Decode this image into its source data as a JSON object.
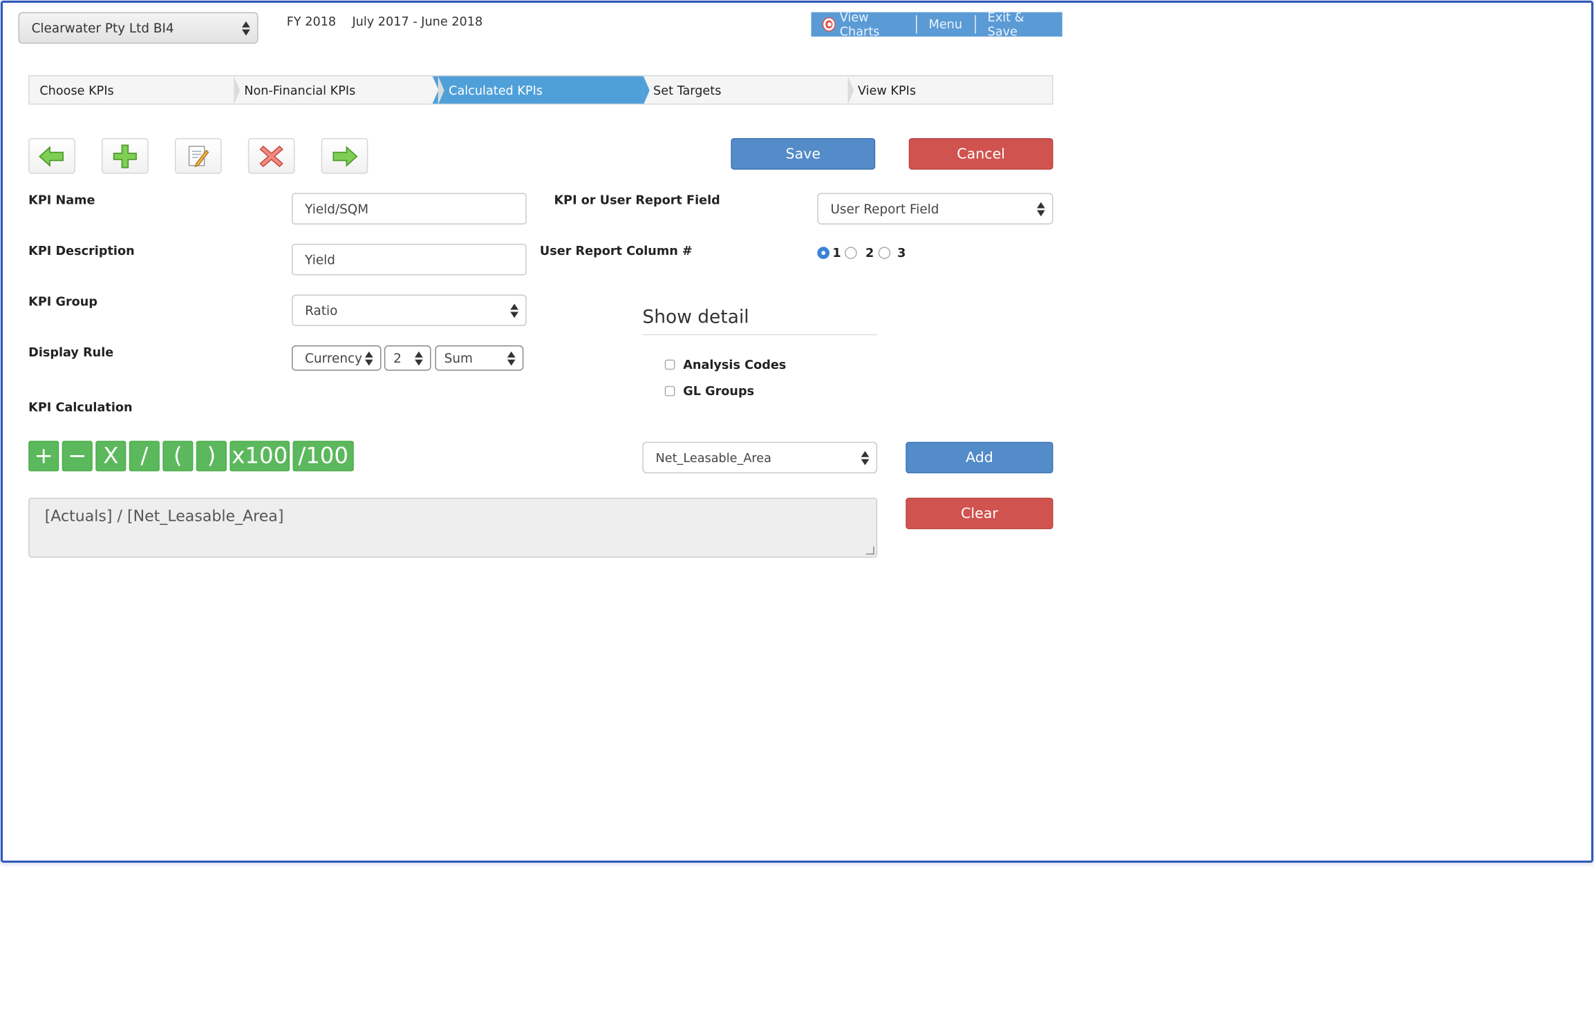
{
  "header": {
    "company": "Clearwater Pty Ltd BI4",
    "fiscal_year": "FY 2018",
    "period": "July 2017 - June 2018",
    "nav": {
      "view_charts": "View Charts",
      "menu": "Menu",
      "exit_save": "Exit & Save"
    }
  },
  "steps": [
    {
      "label": "Choose KPIs",
      "active": false
    },
    {
      "label": "Non-Financial KPIs",
      "active": false
    },
    {
      "label": "Calculated KPIs",
      "active": true
    },
    {
      "label": "Set Targets",
      "active": false
    },
    {
      "label": "View KPIs",
      "active": false
    }
  ],
  "toolbar": {
    "icons": [
      "back-arrow-icon",
      "add-icon",
      "edit-icon",
      "delete-icon",
      "forward-arrow-icon"
    ],
    "save_label": "Save",
    "cancel_label": "Cancel"
  },
  "form": {
    "kpi_name_label": "KPI Name",
    "kpi_name_value": "Yield/SQM",
    "kpi_description_label": "KPI Description",
    "kpi_description_value": "Yield",
    "kpi_group_label": "KPI Group",
    "kpi_group_value": "Ratio",
    "display_rule_label": "Display Rule",
    "display_rule_format": "Currency",
    "display_rule_decimals": "2",
    "display_rule_aggregate": "Sum",
    "kpi_calc_label": "KPI Calculation",
    "field_type_label": "KPI or User Report Field",
    "field_type_value": "User Report Field",
    "column_label": "User Report Column #",
    "column_options": [
      "1",
      "2",
      "3"
    ],
    "column_selected": "1"
  },
  "detail": {
    "title": "Show detail",
    "analysis_codes": "Analysis Codes",
    "gl_groups": "GL Groups"
  },
  "calc": {
    "operators": [
      "+",
      "−",
      "X",
      "/",
      "(",
      ")",
      "x100",
      "/100"
    ],
    "field_select": "Net_Leasable_Area",
    "add_label": "Add",
    "clear_label": "Clear",
    "formula": "[Actuals] / [Net_Leasable_Area]"
  },
  "colors": {
    "active_step": "#4fa0d9",
    "primary": "#548bc9",
    "danger": "#d0534f",
    "operator": "#5cb85c"
  }
}
